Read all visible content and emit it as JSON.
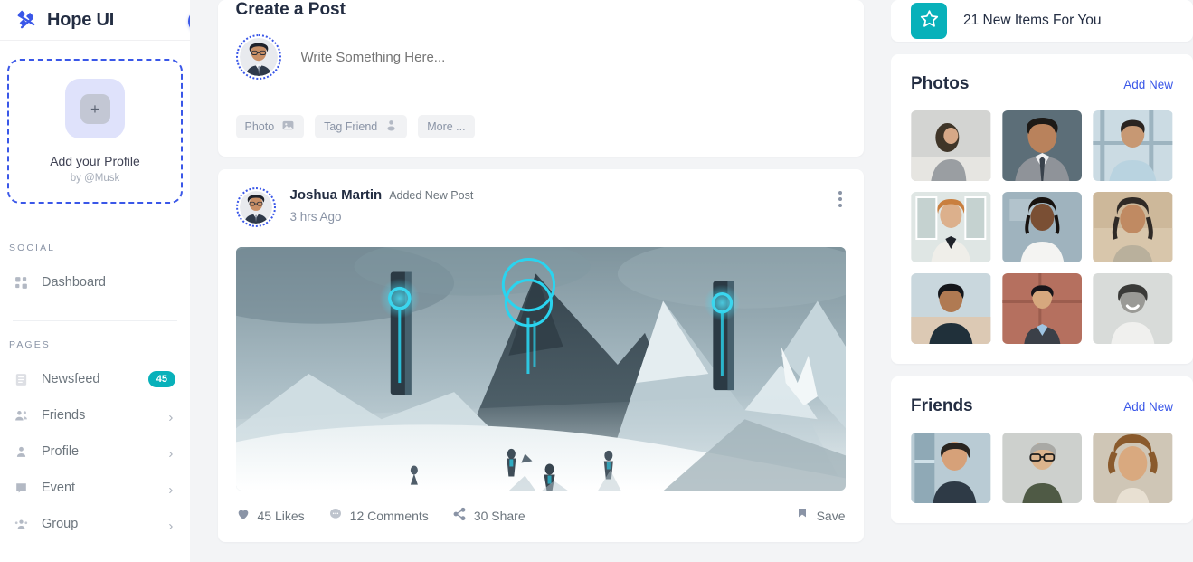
{
  "sidebar": {
    "brand": "Hope UI",
    "logo_icon": "hope-ui-logo",
    "collapse_icon": "arrow-left-icon",
    "accent_color": "#3a57e8",
    "profile_card": {
      "plus_icon": "plus-icon",
      "title": "Add your Profile",
      "subtitle": "by @Musk"
    },
    "group_social_label": "SOCIAL",
    "social_items": [
      {
        "label": "Dashboard",
        "icon": "grid-icon"
      }
    ],
    "group_pages_label": "PAGES",
    "page_items": [
      {
        "label": "Newsfeed",
        "icon": "newsfeed-icon",
        "badge": "45",
        "badge_color": "#08b1ba"
      },
      {
        "label": "Friends",
        "icon": "friends-icon",
        "chevron": "chevron-right-icon"
      },
      {
        "label": "Profile",
        "icon": "profile-icon",
        "chevron": "chevron-right-icon"
      },
      {
        "label": "Event",
        "icon": "event-icon",
        "chevron": "chevron-right-icon"
      },
      {
        "label": "Group",
        "icon": "group-icon",
        "chevron": "chevron-right-icon"
      }
    ]
  },
  "create_post": {
    "title": "Create a Post",
    "avatar_name": "user-avatar",
    "input_placeholder": "Write Something Here...",
    "input_value": "",
    "actions": [
      {
        "label": "Photo",
        "icon": "image-icon"
      },
      {
        "label": "Tag Friend",
        "icon": "person-icon"
      },
      {
        "label": "More ...",
        "icon": ""
      }
    ]
  },
  "post": {
    "author": "Joshua Martin",
    "action_text": "Added New Post",
    "timestamp": "3 hrs Ago",
    "menu_icon": "more-vertical-icon",
    "image_alt": "snowy-mountain-scifi-landscape",
    "stats": [
      {
        "label": "45 Likes",
        "icon": "like-icon"
      },
      {
        "label": "12 Comments",
        "icon": "comment-icon"
      },
      {
        "label": "30 Share",
        "icon": "share-icon"
      }
    ],
    "save_label": "Save",
    "save_icon": "bookmark-icon"
  },
  "right_panel": {
    "news_banner": {
      "icon": "star-icon",
      "text": "21 New Items For You",
      "color": "#08b1ba"
    },
    "photos": {
      "title": "Photos",
      "add_new_label": "Add New",
      "items": [
        {
          "name": "photo-1"
        },
        {
          "name": "photo-2"
        },
        {
          "name": "photo-3"
        },
        {
          "name": "photo-4"
        },
        {
          "name": "photo-5"
        },
        {
          "name": "photo-6"
        },
        {
          "name": "photo-7"
        },
        {
          "name": "photo-8"
        },
        {
          "name": "photo-9"
        }
      ]
    },
    "friends": {
      "title": "Friends",
      "add_new_label": "Add New",
      "items": [
        {
          "name": "friend-1"
        },
        {
          "name": "friend-2"
        },
        {
          "name": "friend-3"
        }
      ]
    }
  }
}
